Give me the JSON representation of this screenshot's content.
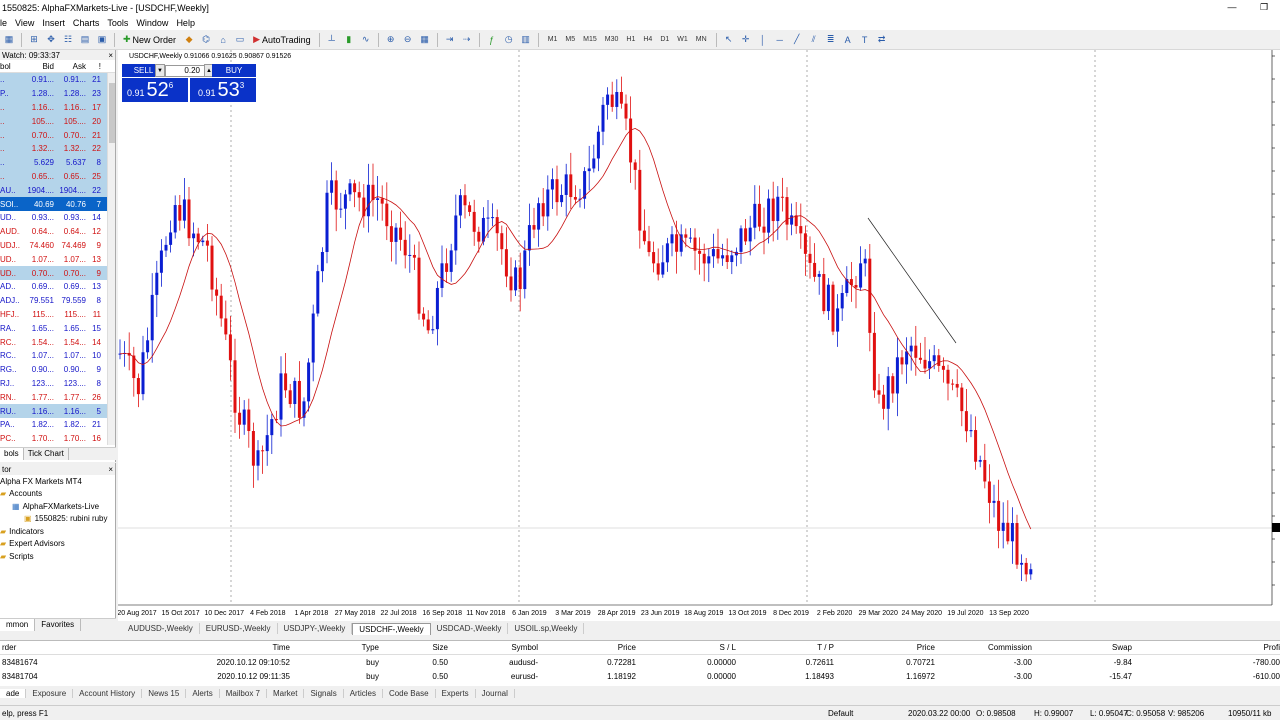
{
  "window": {
    "title": "1550825: AlphaFXMarkets-Live - [USDCHF,Weekly]",
    "min": "—",
    "restore": "❐",
    "close": "✕"
  },
  "menu": [
    "le",
    "View",
    "Insert",
    "Charts",
    "Tools",
    "Window",
    "Help"
  ],
  "toolbar": {
    "new_order": "New Order",
    "autotrading": "AutoTrading",
    "timeframes": [
      "M1",
      "M5",
      "M15",
      "M30",
      "H1",
      "H4",
      "D1",
      "W1",
      "MN"
    ]
  },
  "market_watch": {
    "title": "Watch: 09:33:37",
    "close": "×",
    "columns": [
      "bol",
      "Bid",
      "Ask",
      "!"
    ],
    "rows": [
      {
        "sym": "..",
        "bid": "0.91...",
        "ask": "0.91...",
        "spr": "21",
        "style": "hl"
      },
      {
        "sym": "P..",
        "bid": "1.28...",
        "ask": "1.28...",
        "spr": "23",
        "style": "hl"
      },
      {
        "sym": "..",
        "bid": "1.16...",
        "ask": "1.16...",
        "spr": "17",
        "style": "hl-red"
      },
      {
        "sym": "..",
        "bid": "105....",
        "ask": "105....",
        "spr": "20",
        "style": "hl-red"
      },
      {
        "sym": "..",
        "bid": "0.70...",
        "ask": "0.70...",
        "spr": "21",
        "style": "hl-red"
      },
      {
        "sym": "..",
        "bid": "1.32...",
        "ask": "1.32...",
        "spr": "22",
        "style": "hl-red"
      },
      {
        "sym": "..",
        "bid": "5.629",
        "ask": "5.637",
        "spr": "8",
        "style": "hl"
      },
      {
        "sym": "..",
        "bid": "0.65...",
        "ask": "0.65...",
        "spr": "25",
        "style": "hl-red"
      },
      {
        "sym": "AU..",
        "bid": "1904....",
        "ask": "1904....",
        "spr": "22",
        "style": "hl"
      },
      {
        "sym": "SOI..",
        "bid": "40.69",
        "ask": "40.76",
        "spr": "7",
        "style": "sel"
      },
      {
        "sym": "UD..",
        "bid": "0.93...",
        "ask": "0.93...",
        "spr": "14",
        "style": ""
      },
      {
        "sym": "AUD..",
        "bid": "0.64...",
        "ask": "0.64...",
        "spr": "12",
        "style": "red"
      },
      {
        "sym": "UDJ..",
        "bid": "74.460",
        "ask": "74.469",
        "spr": "9",
        "style": "red"
      },
      {
        "sym": "UD..",
        "bid": "1.07...",
        "ask": "1.07...",
        "spr": "13",
        "style": "red"
      },
      {
        "sym": "UD..",
        "bid": "0.70...",
        "ask": "0.70...",
        "spr": "9",
        "style": "hl-red"
      },
      {
        "sym": "AD..",
        "bid": "0.69...",
        "ask": "0.69...",
        "spr": "13",
        "style": ""
      },
      {
        "sym": "ADJ..",
        "bid": "79.551",
        "ask": "79.559",
        "spr": "8",
        "style": ""
      },
      {
        "sym": "HFJ..",
        "bid": "115....",
        "ask": "115....",
        "spr": "11",
        "style": "red"
      },
      {
        "sym": "RA..",
        "bid": "1.65...",
        "ask": "1.65...",
        "spr": "15",
        "style": ""
      },
      {
        "sym": "RC..",
        "bid": "1.54...",
        "ask": "1.54...",
        "spr": "14",
        "style": "red"
      },
      {
        "sym": "RC..",
        "bid": "1.07...",
        "ask": "1.07...",
        "spr": "10",
        "style": ""
      },
      {
        "sym": "RG..",
        "bid": "0.90...",
        "ask": "0.90...",
        "spr": "9",
        "style": ""
      },
      {
        "sym": "RJ..",
        "bid": "123....",
        "ask": "123....",
        "spr": "8",
        "style": ""
      },
      {
        "sym": "RN..",
        "bid": "1.77...",
        "ask": "1.77...",
        "spr": "26",
        "style": "red"
      },
      {
        "sym": "RU..",
        "bid": "1.16...",
        "ask": "1.16...",
        "spr": "5",
        "style": "hl"
      },
      {
        "sym": "PA..",
        "bid": "1.82...",
        "ask": "1.82...",
        "spr": "21",
        "style": ""
      },
      {
        "sym": "PC..",
        "bid": "1.70...",
        "ask": "1.70...",
        "spr": "16",
        "style": "red"
      }
    ],
    "tabs": [
      "bols",
      "Tick Chart"
    ]
  },
  "navigator": {
    "title": "tor",
    "close": "×",
    "items": [
      {
        "label": "Alpha FX Markets MT4",
        "indent": 0,
        "icon": ""
      },
      {
        "label": "Accounts",
        "indent": 0,
        "icon": "folder"
      },
      {
        "label": "AlphaFXMarkets-Live",
        "indent": 12,
        "icon": "server"
      },
      {
        "label": "1550825: rubini ruby",
        "indent": 24,
        "icon": "account"
      },
      {
        "label": "Indicators",
        "indent": 0,
        "icon": "folder"
      },
      {
        "label": "Expert Advisors",
        "indent": 0,
        "icon": "folder"
      },
      {
        "label": "Scripts",
        "indent": 0,
        "icon": "folder"
      }
    ],
    "tabs": [
      "mmon",
      "Favorites"
    ]
  },
  "chart": {
    "title": "USDCHF,Weekly  0.91066 0.91625 0.90867 0.91526",
    "otp": {
      "sell": "SELL",
      "buy": "BUY",
      "lots": "0.20",
      "sell_a": "0.91",
      "sell_b": "52",
      "sell_c": "6",
      "buy_a": "0.91",
      "buy_b": "53",
      "buy_c": "3"
    },
    "dates": [
      "20 Aug 2017",
      "15 Oct 2017",
      "10 Dec 2017",
      "4 Feb 2018",
      "1 Apr 2018",
      "27 May 2018",
      "22 Jul 2018",
      "16 Sep 2018",
      "11 Nov 2018",
      "6 Jan 2019",
      "3 Mar 2019",
      "28 Apr 2019",
      "23 Jun 2019",
      "18 Aug 2019",
      "13 Oct 2019",
      "8 Dec 2019",
      "2 Feb 2020",
      "29 Mar 2020",
      "24 May 2020",
      "19 Jul 2020",
      "13 Sep 2020"
    ],
    "colors": {
      "up": "#0a1ed2",
      "down": "#e01010",
      "ma": "#c81010",
      "bg": "#ffffff"
    }
  },
  "chart_tabs": [
    "AUDUSD-,Weekly",
    "EURUSD-,Weekly",
    "USDJPY-,Weekly",
    "USDCHF-,Weekly",
    "USDCAD-,Weekly",
    "USOIL.sp,Weekly"
  ],
  "chart_tab_active": 3,
  "terminal": {
    "headers": [
      "rder",
      "Time",
      "Type",
      "Size",
      "Symbol",
      "Price",
      "S / L",
      "T / P",
      "Price",
      "Commission",
      "Swap",
      "Profi"
    ],
    "rows": [
      [
        "83481674",
        "2020.10.12 09:10:52",
        "buy",
        "0.50",
        "audusd-",
        "0.72281",
        "0.00000",
        "0.72611",
        "0.70721",
        "-3.00",
        "-9.84",
        "-780.00"
      ],
      [
        "83481704",
        "2020.10.12 09:11:35",
        "buy",
        "0.50",
        "eurusd-",
        "1.18192",
        "0.00000",
        "1.18493",
        "1.16972",
        "-3.00",
        "-15.47",
        "-610.00"
      ]
    ],
    "tabs": [
      "ade",
      "Exposure",
      "Account History",
      "News 15",
      "Alerts",
      "Mailbox 7",
      "Market",
      "Signals",
      "Articles",
      "Code Base",
      "Experts",
      "Journal"
    ]
  },
  "status": {
    "help": "elp, press F1",
    "profile": "Default",
    "time": "2020.03.22 00:00",
    "o": "O: 0.98508",
    "h": "H: 0.99007",
    "l": "L: 0.95047",
    "c": "C: 0.95058",
    "v": "V: 985206",
    "traffic": "10950/11 kb"
  }
}
